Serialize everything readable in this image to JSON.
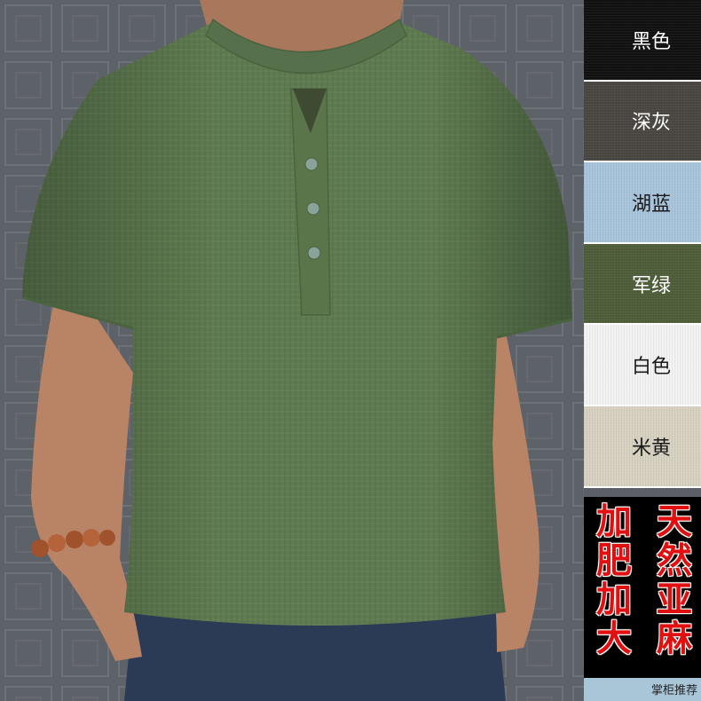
{
  "image_description": "",
  "swatches": [
    {
      "label": "黑色",
      "color": "#111111",
      "text_color": "#ffffff"
    },
    {
      "label": "深灰",
      "color": "#4a4641",
      "text_color": "#ffffff"
    },
    {
      "label": "湖蓝",
      "color": "#a9c5dc",
      "text_color": "#1a1a1a"
    },
    {
      "label": "军绿",
      "color": "#4f5e3a",
      "text_color": "#ffffff"
    },
    {
      "label": "白色",
      "color": "#f4f4f4",
      "text_color": "#1a1a1a"
    },
    {
      "label": "米黄",
      "color": "#d8d2c2",
      "text_color": "#1a1a1a"
    }
  ],
  "promo": {
    "left_chars": [
      "加",
      "肥",
      "加",
      "大"
    ],
    "right_chars": [
      "天",
      "然",
      "亚",
      "麻"
    ],
    "recommend": "掌柜推荐"
  },
  "colors": {
    "shirt": "#5e7a50",
    "wall": "#5d6168",
    "skin": "#b98466",
    "jeans": "#2b3a55",
    "promo_red": "#e01010"
  }
}
